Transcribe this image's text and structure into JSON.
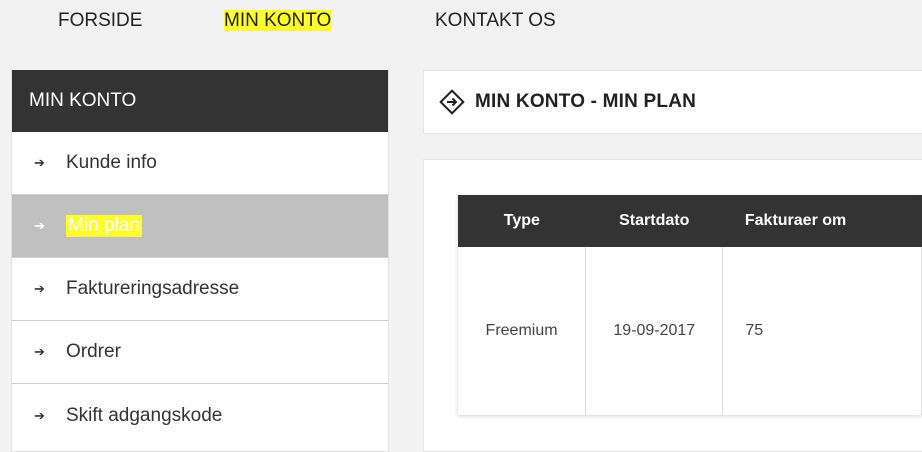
{
  "nav": {
    "items": [
      {
        "label": "FORSIDE"
      },
      {
        "label": "MIN KONTO"
      },
      {
        "label": "KONTAKT OS"
      }
    ]
  },
  "sidebar": {
    "title": "MIN KONTO",
    "items": [
      {
        "label": "Kunde info"
      },
      {
        "label": "Min plan"
      },
      {
        "label": "Faktureringsadresse"
      },
      {
        "label": "Ordrer"
      },
      {
        "label": "Skift adgangskode"
      }
    ]
  },
  "main": {
    "title": "MIN KONTO - MIN PLAN",
    "table": {
      "headers": [
        "Type",
        "Startdato",
        "Fakturaer om"
      ],
      "rows": [
        [
          "Freemium",
          "19-09-2017",
          "75"
        ]
      ]
    }
  },
  "colors": {
    "highlight": "#ffff2e",
    "dark": "#333333",
    "active_item": "#c0c0c0"
  },
  "icons": {
    "arrow": "right-arrow-icon",
    "title": "diamond-arrow-icon"
  }
}
